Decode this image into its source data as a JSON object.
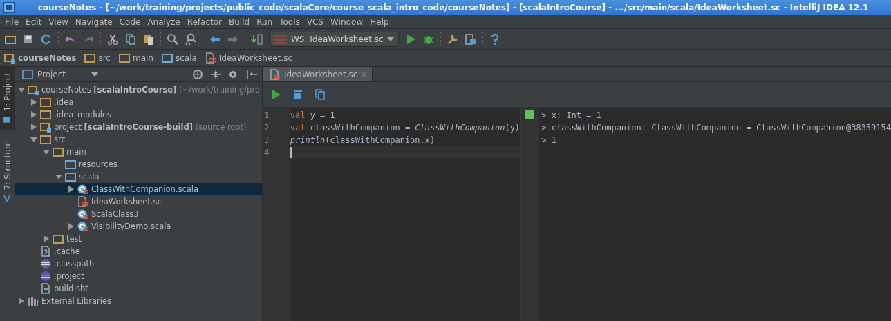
{
  "window": {
    "title": "courseNotes - [~/work/training/projects/public_code/scalaCore/course_scala_intro_code/courseNotes] - [scalaIntroCourse] - .../src/main/scala/IdeaWorksheet.sc - IntelliJ IDEA 12.1"
  },
  "menu": [
    "File",
    "Edit",
    "View",
    "Navigate",
    "Code",
    "Analyze",
    "Refactor",
    "Build",
    "Run",
    "Tools",
    "VCS",
    "Window",
    "Help"
  ],
  "toolbar": {
    "run_config": "WS: IdeaWorksheet.sc"
  },
  "breadcrumbs": [
    {
      "label": "courseNotes",
      "kind": "module"
    },
    {
      "label": "src",
      "kind": "folder"
    },
    {
      "label": "main",
      "kind": "folder"
    },
    {
      "label": "scala",
      "kind": "source"
    },
    {
      "label": "IdeaWorksheet.sc",
      "kind": "worksheet"
    }
  ],
  "side_tabs": [
    {
      "label": "1: Project",
      "selected": true
    },
    {
      "label": "7: Structure",
      "selected": false
    }
  ],
  "project_panel": {
    "view": "Project",
    "tree": [
      {
        "name": "courseNotes",
        "module": "[scalaIntroCourse]",
        "note": "(~/work/training/pro",
        "kind": "module",
        "expanded": true,
        "selected": false,
        "children": [
          {
            "name": ".idea",
            "kind": "folder",
            "expanded": false,
            "selected": false
          },
          {
            "name": ".idea_modules",
            "kind": "folder",
            "expanded": false,
            "selected": false
          },
          {
            "name": "project",
            "module": "[scalaIntroCourse-build]",
            "note": "(source root)",
            "kind": "module",
            "expanded": false,
            "selected": false
          },
          {
            "name": "src",
            "kind": "folder",
            "expanded": true,
            "selected": false,
            "children": [
              {
                "name": "main",
                "kind": "folder",
                "expanded": true,
                "selected": false,
                "children": [
                  {
                    "name": "resources",
                    "kind": "source",
                    "selected": false
                  },
                  {
                    "name": "scala",
                    "kind": "source",
                    "expanded": true,
                    "selected": false,
                    "children": [
                      {
                        "name": "ClassWithCompanion.scala",
                        "kind": "scala",
                        "expanded": false,
                        "selected": true
                      },
                      {
                        "name": "IdeaWorksheet.sc",
                        "kind": "worksheet",
                        "selected": false
                      },
                      {
                        "name": "ScalaClass3",
                        "kind": "scala",
                        "selected": false
                      },
                      {
                        "name": "VisibilityDemo.scala",
                        "kind": "scala",
                        "expanded": false,
                        "selected": false
                      }
                    ]
                  }
                ]
              },
              {
                "name": "test",
                "kind": "folder",
                "expanded": false,
                "selected": false
              }
            ]
          },
          {
            "name": ".cache",
            "kind": "unknown",
            "selected": false
          },
          {
            "name": ".classpath",
            "kind": "eclipse",
            "selected": false
          },
          {
            "name": ".project",
            "kind": "eclipse",
            "selected": false
          },
          {
            "name": "build.sbt",
            "kind": "text",
            "selected": false
          }
        ]
      },
      {
        "name": "External Libraries",
        "kind": "libraries",
        "expanded": false,
        "selected": false
      }
    ]
  },
  "editor": {
    "tabs": [
      {
        "label": "IdeaWorksheet.sc",
        "selected": true
      }
    ],
    "lines": [
      {
        "number": "1",
        "current": false,
        "tokens": [
          {
            "kind": "keyword",
            "text": "val"
          },
          {
            "kind": "plain",
            "text": " y = 1"
          }
        ]
      },
      {
        "number": "2",
        "current": false,
        "tokens": [
          {
            "kind": "keyword",
            "text": "val"
          },
          {
            "kind": "plain",
            "text": " classWithCompanion = "
          },
          {
            "kind": "italic",
            "text": "ClassWithCompanion"
          },
          {
            "kind": "plain",
            "text": "(y)"
          }
        ]
      },
      {
        "number": "3",
        "current": false,
        "tokens": [
          {
            "kind": "italic",
            "text": "println"
          },
          {
            "kind": "plain",
            "text": "(classWithCompanion.x)"
          }
        ]
      },
      {
        "number": "4",
        "current": true
      }
    ],
    "output": [
      "> x: Int = 1",
      "> classWithCompanion: ClassWithCompanion = ClassWithCompanion@38359154",
      "> 1"
    ]
  }
}
